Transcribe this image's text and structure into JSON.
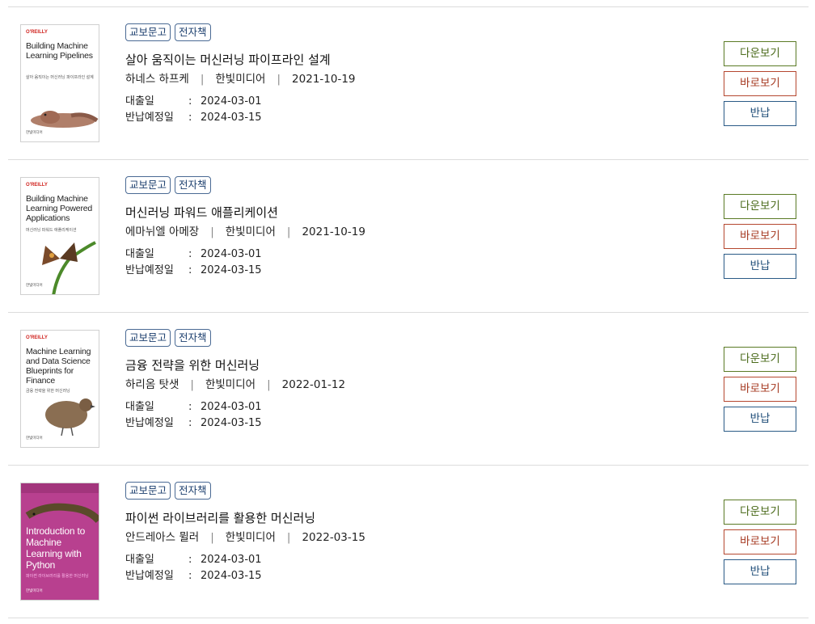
{
  "labels": {
    "loan_date": "대출일",
    "due_date": "반납예정일",
    "colon": ":",
    "separator": "|",
    "download": "다운보기",
    "read": "바로보기",
    "return": "반납"
  },
  "books": [
    {
      "badges": [
        "교보문고",
        "전자책"
      ],
      "title": "살아 움직이는 머신러닝 파이프라인 설계",
      "author": "하네스 하프케",
      "publisher": "한빛미디어",
      "pub_date": "2021-10-19",
      "loan_date": "2024-03-01",
      "due_date": "2024-03-15",
      "cover": {
        "publisher_logo": "O'REILLY",
        "title": "Building Machine Learning Pipelines",
        "subtitle": "살아 움직이는 머신러닝 파이프라인 설계",
        "footer": "한빛미디어",
        "animal": "axolotl",
        "bg": "#ffffff"
      }
    },
    {
      "badges": [
        "교보문고",
        "전자책"
      ],
      "title": "머신러닝 파워드 애플리케이션",
      "author": "에마뉘엘 아메장",
      "publisher": "한빛미디어",
      "pub_date": "2021-10-19",
      "loan_date": "2024-03-01",
      "due_date": "2024-03-15",
      "cover": {
        "publisher_logo": "O'REILLY",
        "title": "Building Machine Learning Powered Applications",
        "subtitle": "머신러닝 파워드 애플리케이션",
        "footer": "한빛미디어",
        "animal": "butterfly",
        "bg": "#ffffff"
      }
    },
    {
      "badges": [
        "교보문고",
        "전자책"
      ],
      "title": "금융 전략을 위한 머신러닝",
      "author": "하리옴 탓샛",
      "publisher": "한빛미디어",
      "pub_date": "2022-01-12",
      "loan_date": "2024-03-01",
      "due_date": "2024-03-15",
      "cover": {
        "publisher_logo": "O'REILLY",
        "title": "Machine Learning and Data Science Blueprints for Finance",
        "subtitle": "금융 전략을 위한 머신러닝",
        "footer": "한빛미디어",
        "animal": "quail",
        "bg": "#ffffff"
      }
    },
    {
      "badges": [
        "교보문고",
        "전자책"
      ],
      "title": "파이썬 라이브러리를 활용한 머신러닝",
      "author": "안드레아스 뮐러",
      "publisher": "한빛미디어",
      "pub_date": "2022-03-15",
      "loan_date": "2024-03-01",
      "due_date": "2024-03-15",
      "cover": {
        "publisher_logo": "",
        "title": "Introduction to Machine Learning with Python",
        "subtitle": "파이썬 라이브러리를 활용한 머신러닝",
        "footer": "한빛미디어",
        "animal": "salamander",
        "bg": "#b8408f"
      }
    }
  ]
}
